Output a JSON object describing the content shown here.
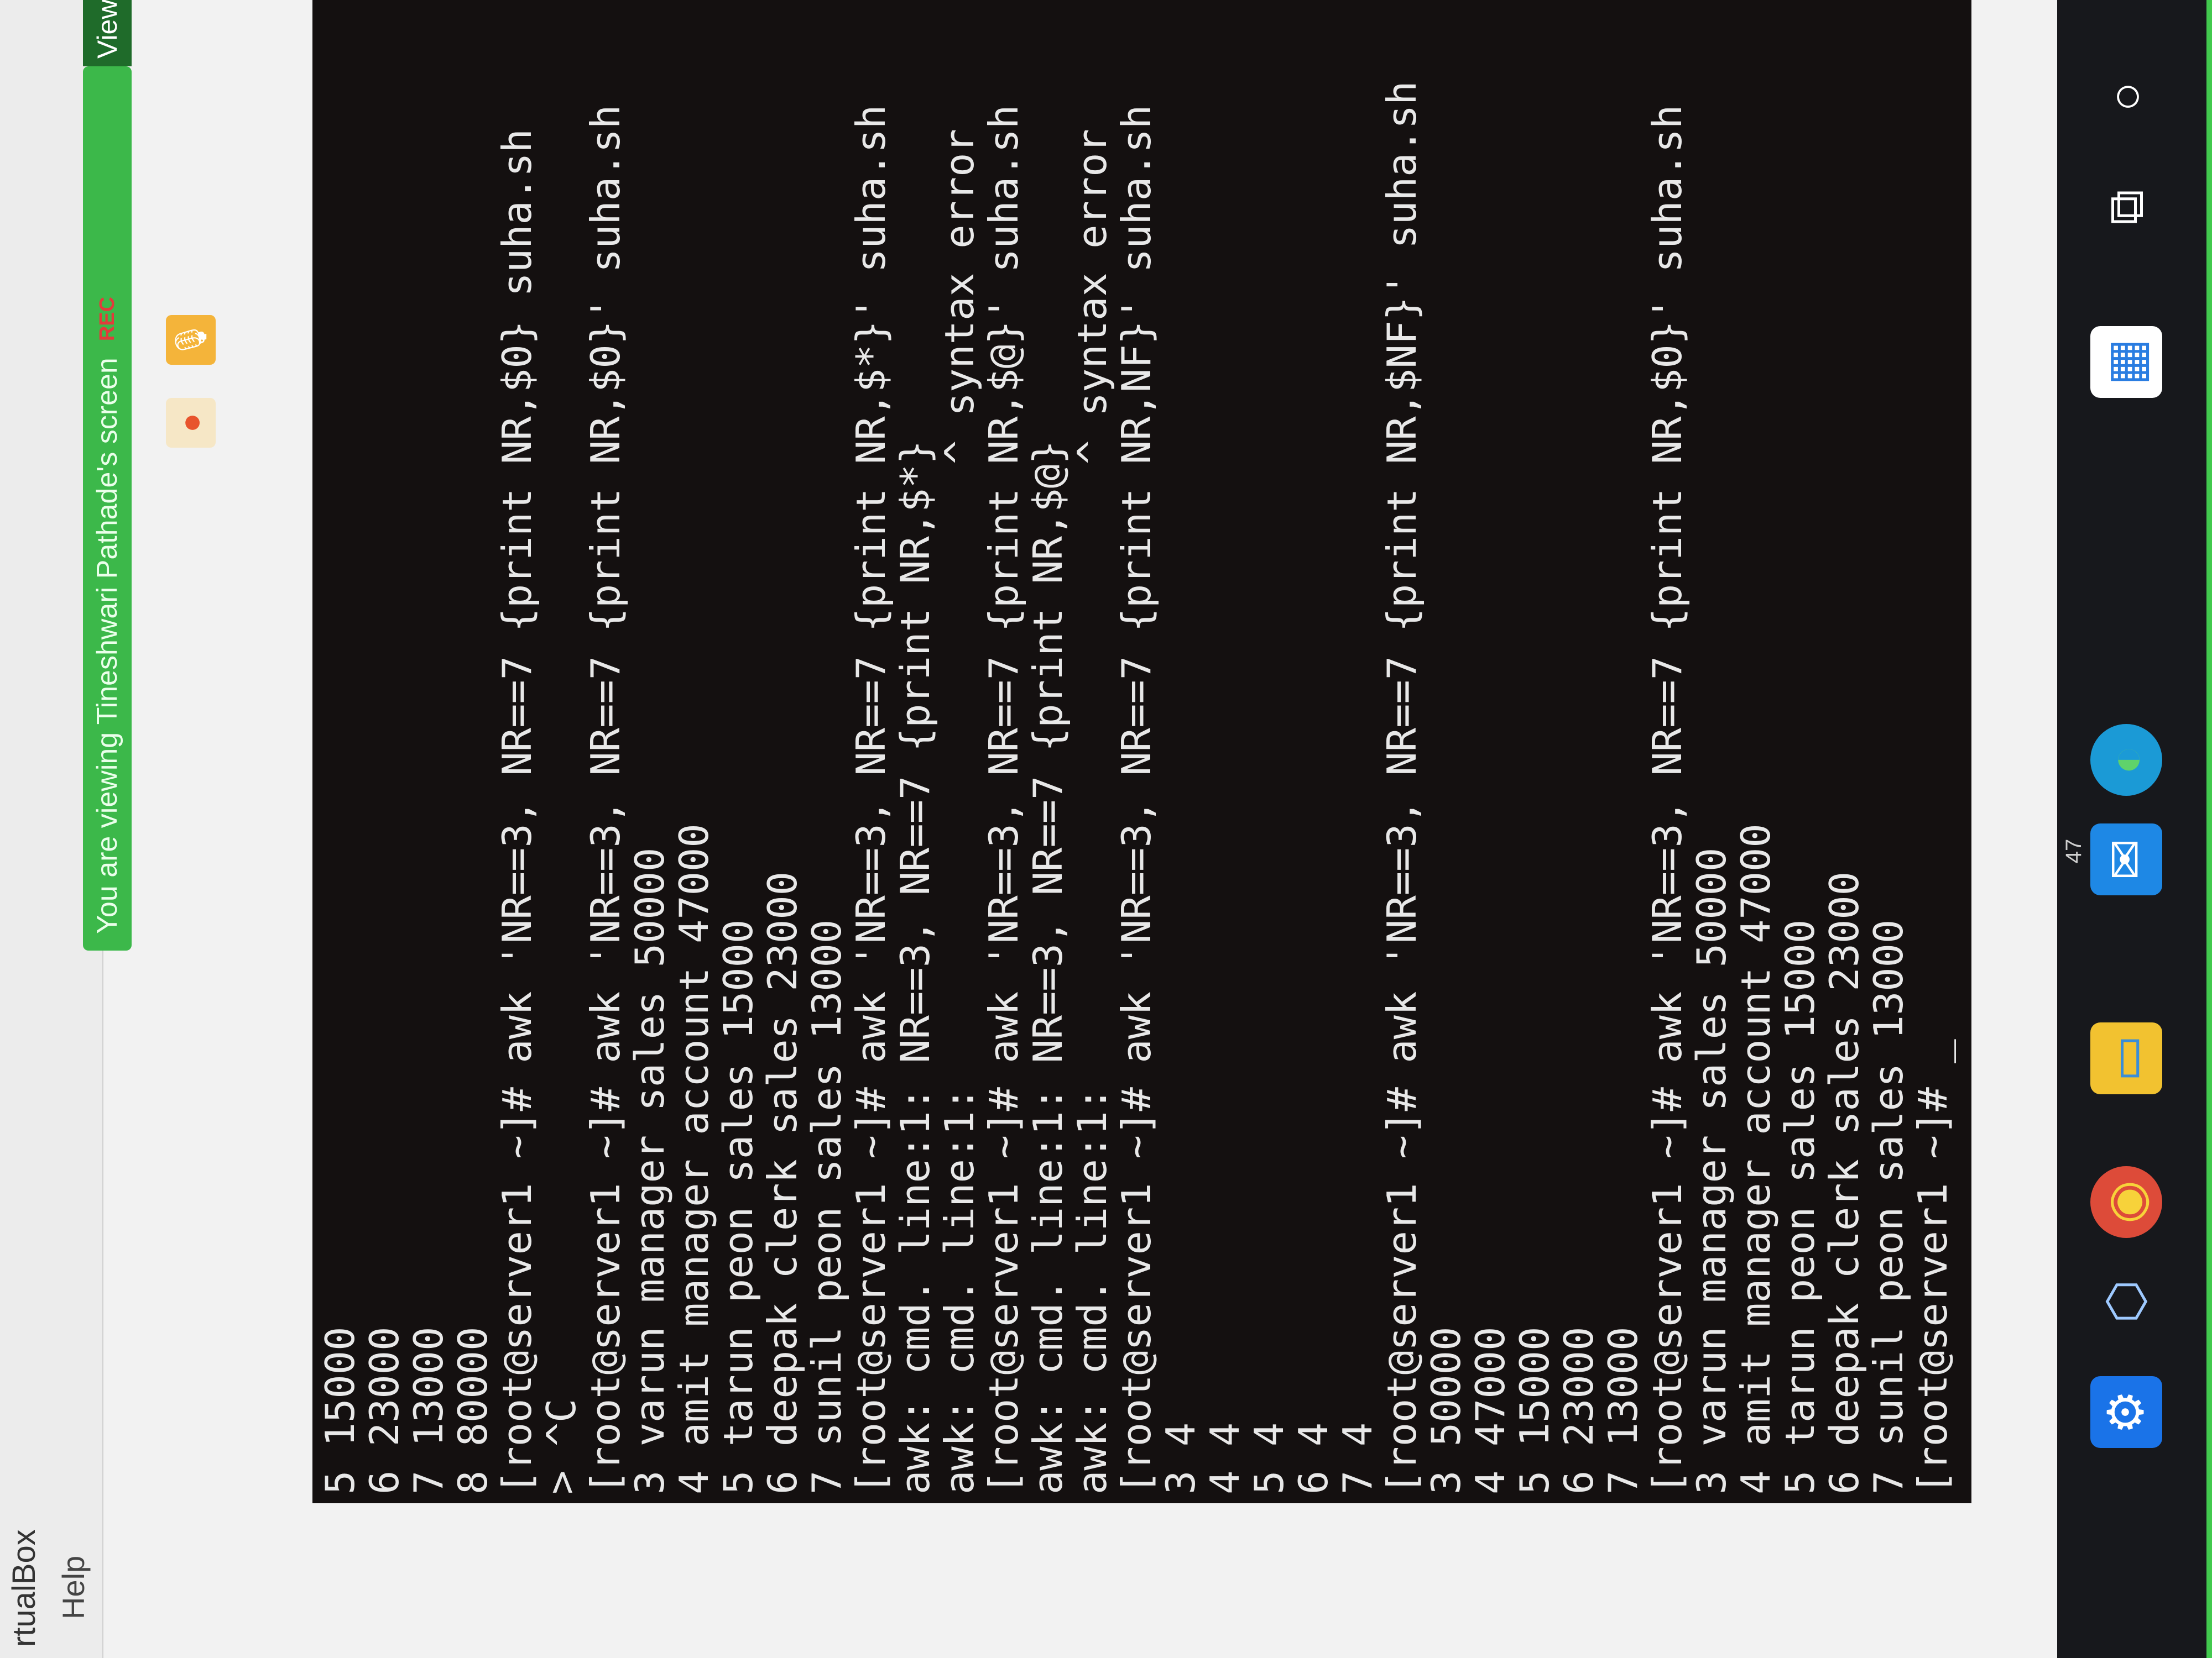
{
  "window": {
    "title": "rtualBox",
    "menu_help": "Help"
  },
  "zoom": {
    "banner": "You are viewing Tineshwari Pathade's screen",
    "rec": "REC",
    "view_options": "View"
  },
  "taskbar": {
    "weather_temp": "47"
  },
  "terminal": {
    "lines": [
      "5 15000",
      "6 23000",
      "7 13000",
      "8 80000",
      "[root@server1 ~]# awk 'NR==3, NR==7 {print NR,$0} suha.sh",
      "> ^C",
      "[root@server1 ~]# awk 'NR==3, NR==7 {print NR,$0}' suha.sh",
      "3 varun manager sales 50000",
      "4 amit manager account 47000",
      "5 tarun peon sales 15000",
      "6 deepak clerk sales 23000",
      "7 sunil peon sales 13000",
      "[root@server1 ~]# awk 'NR==3, NR==7 {print NR,$*}' suha.sh",
      "awk: cmd. line:1: NR==3, NR==7 {print NR,$*}",
      "awk: cmd. line:1:                          ^ syntax error",
      "[root@server1 ~]# awk 'NR==3, NR==7 {print NR,$@}' suha.sh",
      "awk: cmd. line:1: NR==3, NR==7 {print NR,$@}",
      "awk: cmd. line:1:                          ^ syntax error",
      "[root@server1 ~]# awk 'NR==3, NR==7 {print NR,NF}' suha.sh",
      "3 4",
      "4 4",
      "5 4",
      "6 4",
      "7 4",
      "[root@server1 ~]# awk 'NR==3, NR==7 {print NR,$NF}' suha.sh",
      "3 50000",
      "4 47000",
      "5 15000",
      "6 23000",
      "7 13000",
      "[root@server1 ~]# awk 'NR==3, NR==7 {print NR,$0}' suha.sh",
      "3 varun manager sales 50000",
      "4 amit manager account 47000",
      "5 tarun peon sales 15000",
      "6 deepak clerk sales 23000",
      "7 sunil peon sales 13000",
      "[root@server1 ~]# _"
    ]
  }
}
